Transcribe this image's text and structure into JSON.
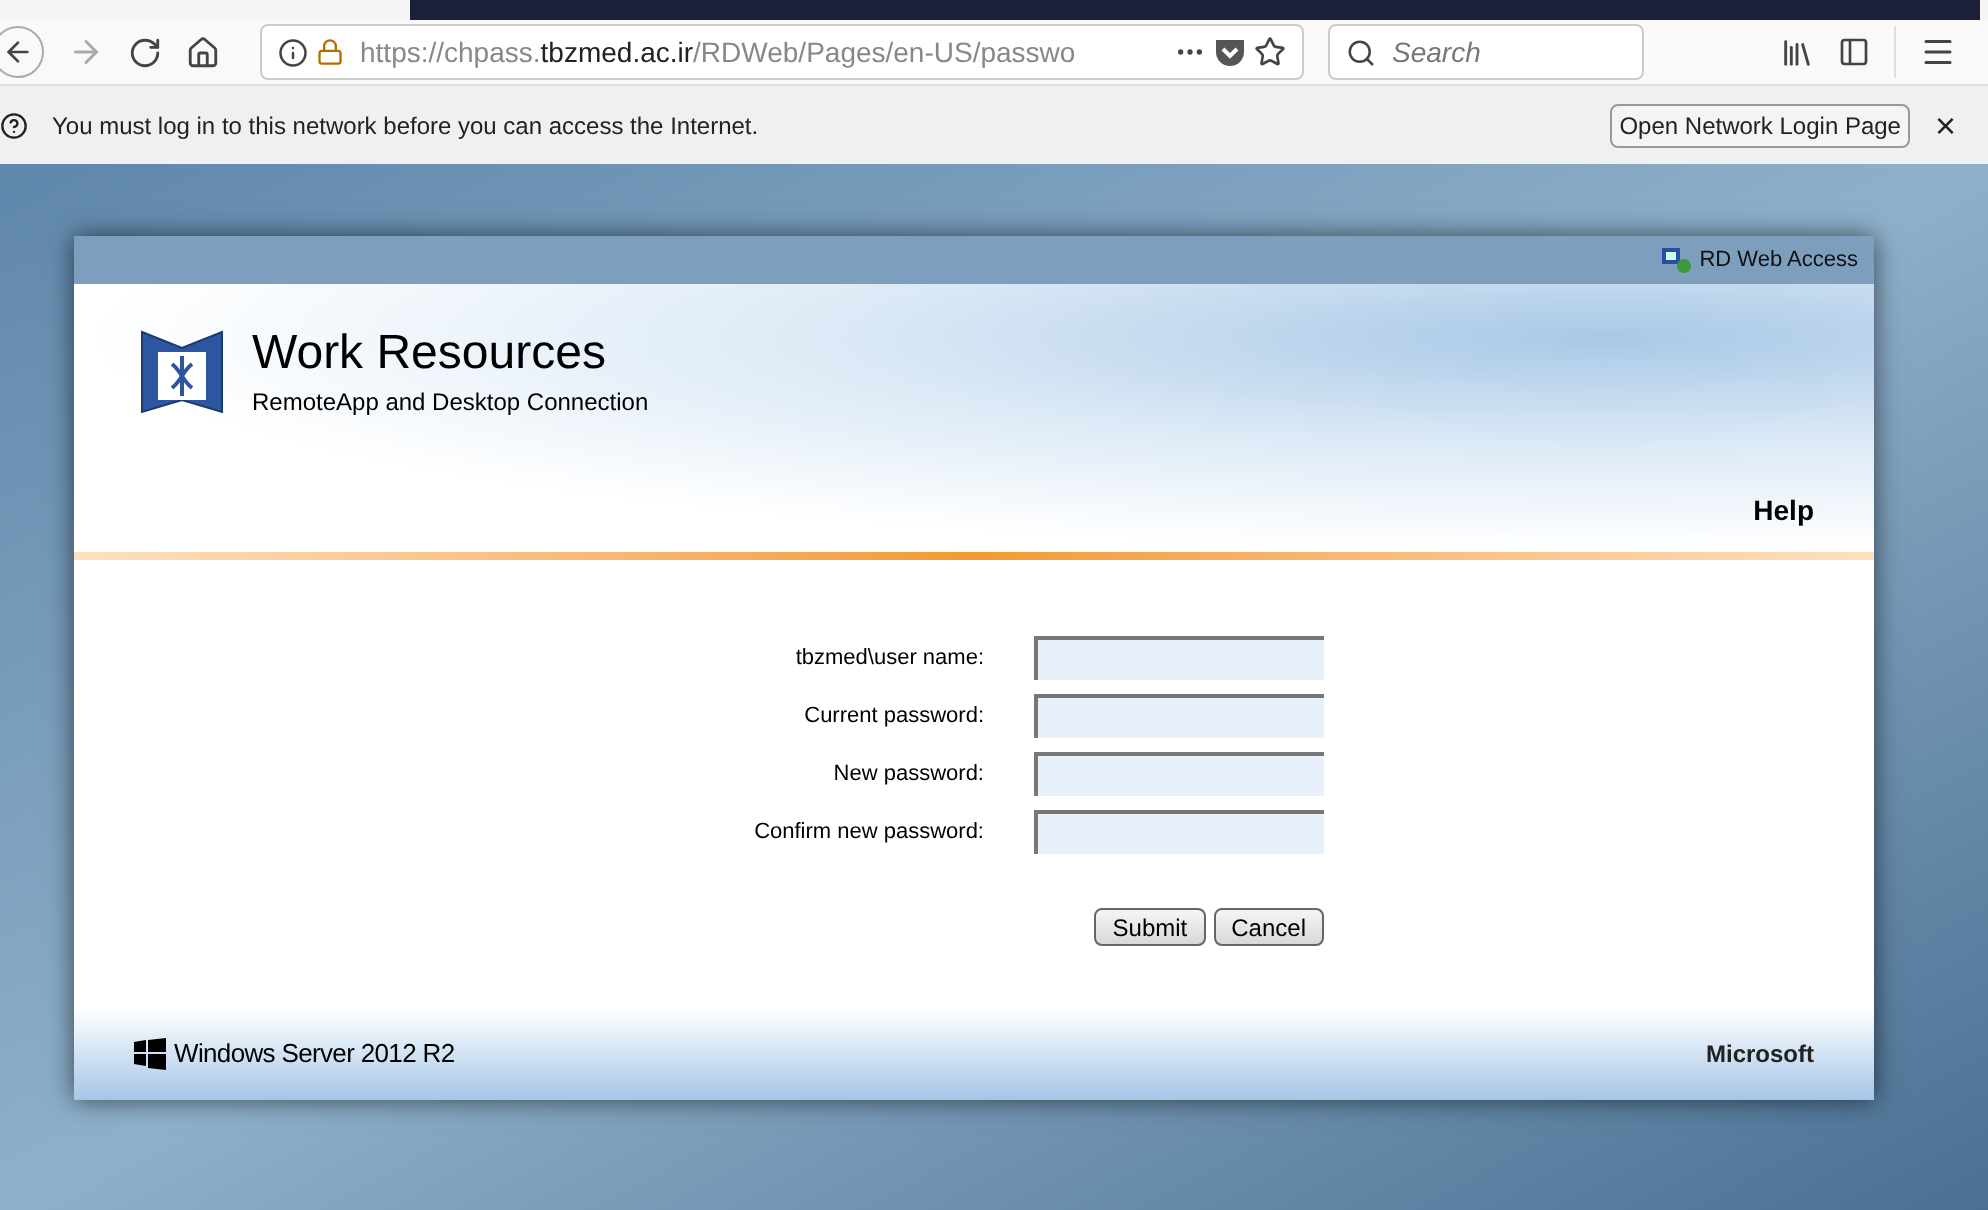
{
  "toolbar": {
    "url": {
      "scheme": "https://chpass.",
      "domain": "tbzmed.ac.ir",
      "path": "/RDWeb/Pages/en-US/passwo"
    },
    "search": {
      "placeholder": "Search"
    }
  },
  "notification": {
    "message": "You must log in to this network before you can access the Internet.",
    "button": "Open Network Login Page",
    "close": "×"
  },
  "panel": {
    "top_link": "RD Web Access",
    "title": "Work Resources",
    "subtitle": "RemoteApp and Desktop Connection",
    "help": "Help",
    "fields": [
      {
        "label": "tbzmed\\user name:"
      },
      {
        "label": "Current password:"
      },
      {
        "label": "New password:"
      },
      {
        "label": "Confirm new password:"
      }
    ],
    "buttons": [
      "Submit",
      "Cancel"
    ],
    "footer_left": "Windows Server 2012 R2",
    "footer_right": "Microsoft"
  }
}
